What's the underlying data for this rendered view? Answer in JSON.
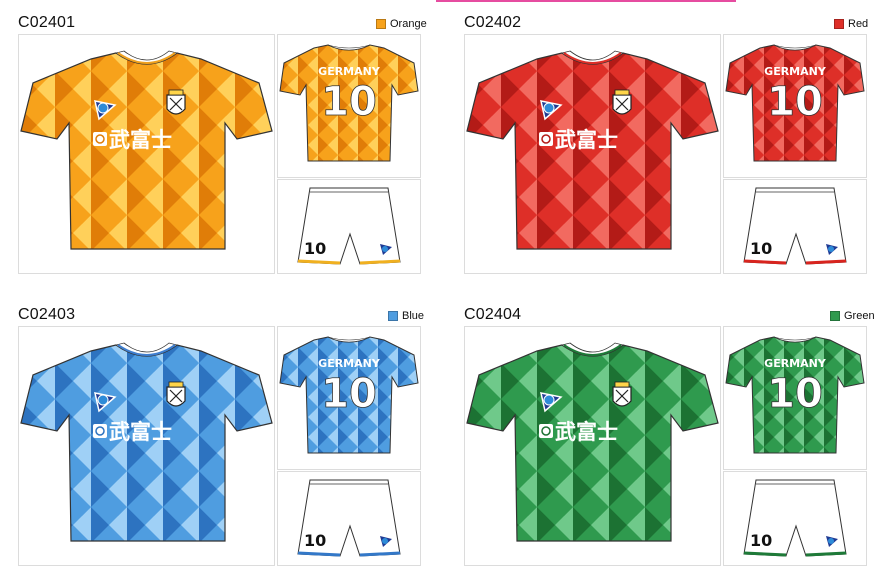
{
  "products": [
    {
      "code": "C02401",
      "color_name": "Orange",
      "primary": "#f7a21b",
      "dark": "#e07d08",
      "light": "#ffd05a",
      "collar_stripe": "#f0a11e",
      "hem": "#f0b020",
      "sponsor": "武富士",
      "player_name": "GERMANY",
      "number": "10",
      "shorts_number": "10"
    },
    {
      "code": "C02402",
      "color_name": "Red",
      "primary": "#de2f28",
      "dark": "#b31b17",
      "light": "#f26a60",
      "collar_stripe": "#de2f28",
      "hem": "#d8241e",
      "sponsor": "武富士",
      "player_name": "GERMANY",
      "number": "10",
      "shorts_number": "10"
    },
    {
      "code": "C02403",
      "color_name": "Blue",
      "primary": "#4f9de0",
      "dark": "#2d73c0",
      "light": "#9fd0f6",
      "collar_stripe": "#3f7fd0",
      "hem": "#3378c8",
      "sponsor": "武富士",
      "player_name": "GERMANY",
      "number": "10",
      "shorts_number": "10"
    },
    {
      "code": "C02404",
      "color_name": "Green",
      "primary": "#2f9a4e",
      "dark": "#1c7233",
      "light": "#6fc98a",
      "collar_stripe": "#1e7a38",
      "hem": "#1e7a38",
      "sponsor": "武富士",
      "player_name": "GERMANY",
      "number": "10",
      "shorts_number": "10"
    }
  ]
}
